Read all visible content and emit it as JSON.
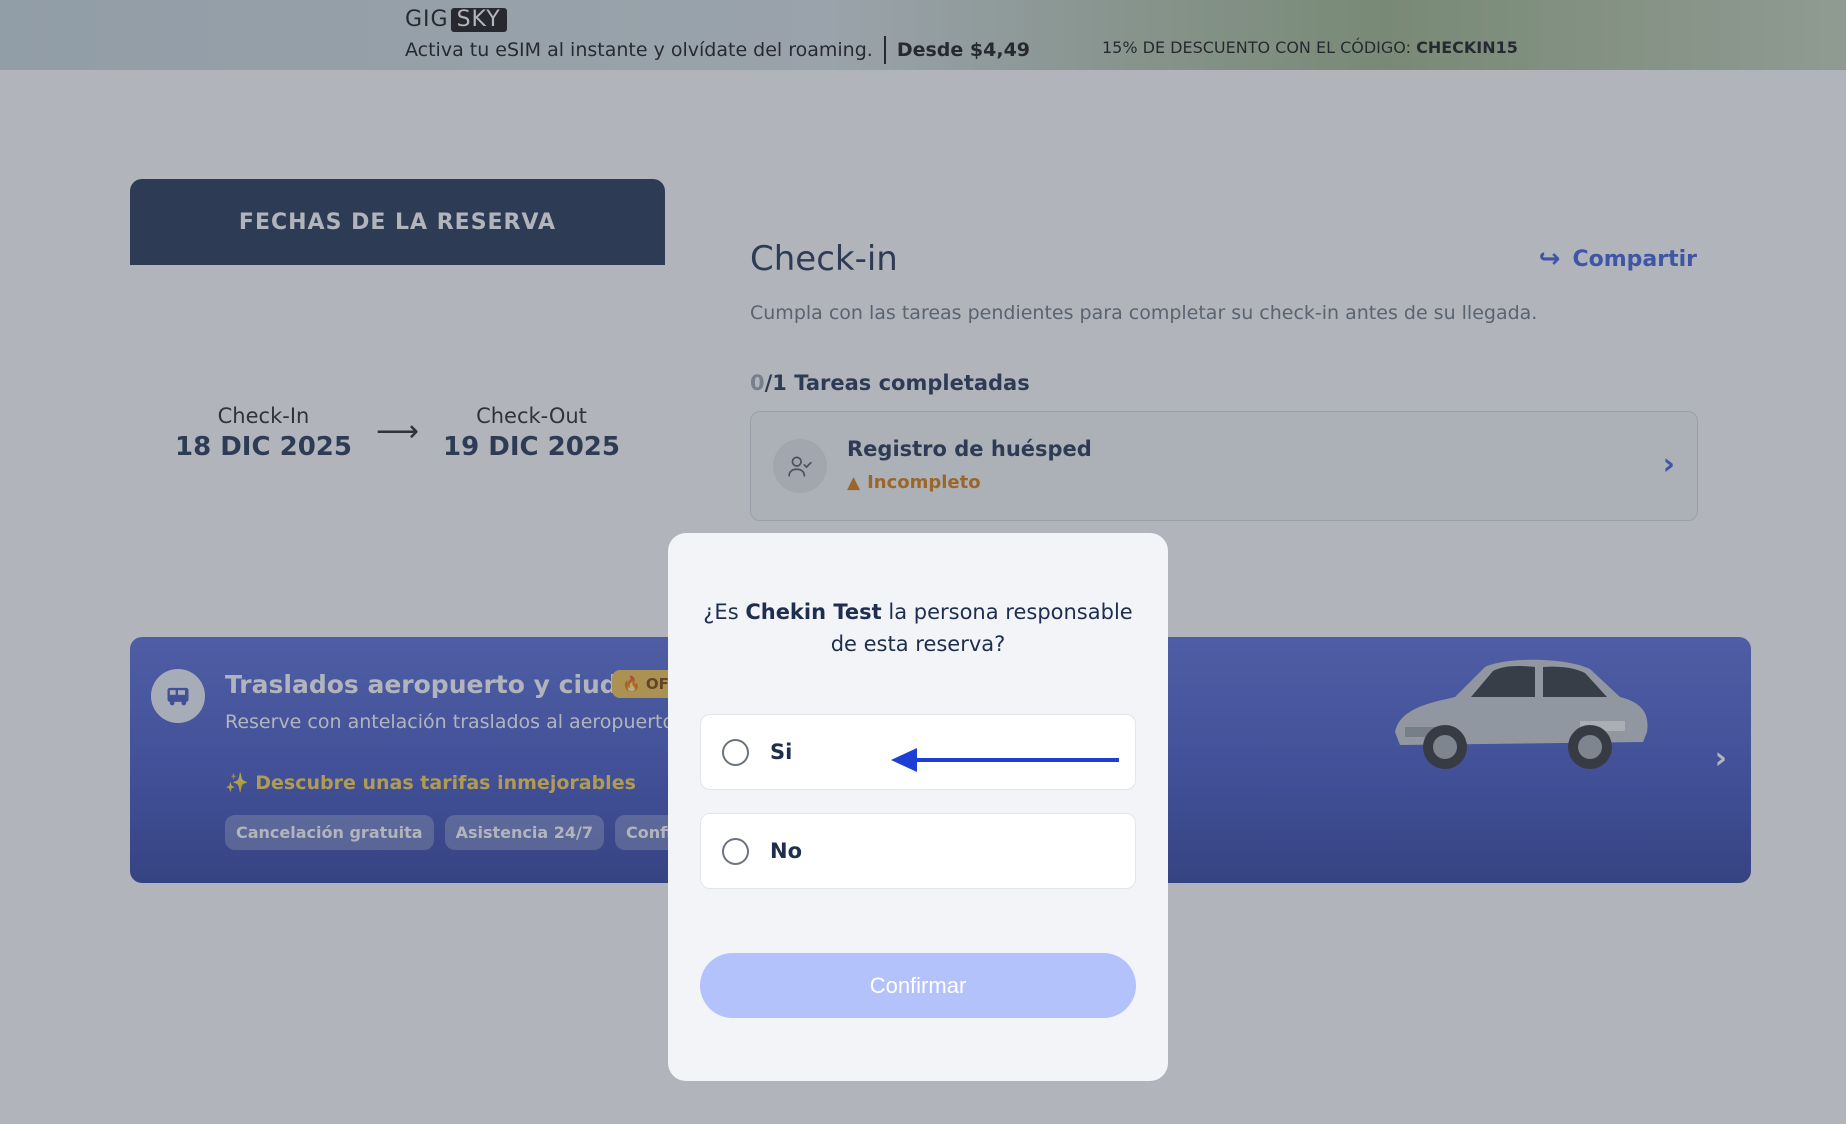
{
  "promo": {
    "logo_part1": "GIG",
    "logo_part2": "SKY",
    "text": "Activa tu eSIM al instante y olvídate del roaming.",
    "price": "Desde $4,49",
    "code_prefix": "15% DE DESCUENTO CON EL CÓDIGO:",
    "code": "CHECKIN15"
  },
  "dates": {
    "header": "FECHAS DE LA RESERVA",
    "checkin_label": "Check-In",
    "checkin_value": "18 DIC 2025",
    "checkout_label": "Check-Out",
    "checkout_value": "19 DIC 2025",
    "arrow": "⟶"
  },
  "checkin": {
    "title": "Check-in",
    "share_label": "Compartir",
    "share_icon": "↪",
    "subtitle": "Cumpla con las tareas pendientes para completar su check-in antes de su llegada.",
    "tasks_done": "0",
    "tasks_total_label": "/1 Tareas completadas",
    "task": {
      "name": "Registro de huésped",
      "status": "Incompleto",
      "status_color": "#d97706",
      "icon": "user-check-icon"
    }
  },
  "transfer": {
    "title": "Traslados aeropuerto y ciudad",
    "badge": "🔥 OF",
    "description": "Reserve con antelación traslados al aeropuerto                                                                                r momento y en cualquier lugar.",
    "promo": "✨ Descubre unas tarifas inmejorables",
    "chips": [
      "Cancelación gratuita",
      "Asistencia 24/7",
      "Confirm"
    ]
  },
  "modal": {
    "question_prefix": "¿Es",
    "question_name": "Chekin Test",
    "question_suffix": "la persona responsable de esta reserva?",
    "options": [
      "Si",
      "No"
    ],
    "confirm_label": "Confirmar",
    "accent_color": "#3b5bdb"
  }
}
